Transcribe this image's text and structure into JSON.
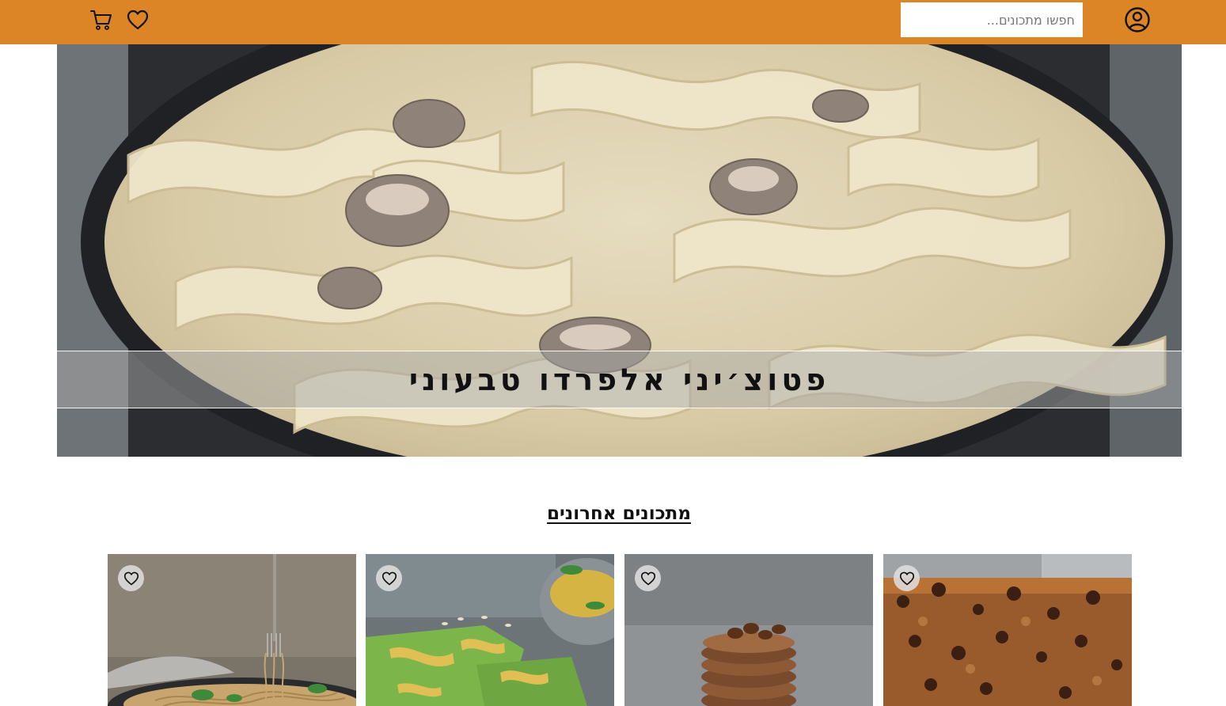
{
  "header": {
    "search_placeholder": "חפשו מתכונים...",
    "search_value": "",
    "icons": [
      "user-icon",
      "heart-icon",
      "cart-icon"
    ],
    "color": "#dc8526"
  },
  "hero": {
    "title": "פטוצ׳יני אלפרדו טבעוני",
    "image": "fettuccine-alfredo-photo"
  },
  "recent": {
    "heading": "מתכונים אחרונים",
    "cards": [
      {
        "image": "chocolate-chip-cake-photo",
        "fav_icon": "heart-icon"
      },
      {
        "image": "pancakes-stack-photo",
        "fav_icon": "heart-icon"
      },
      {
        "image": "green-spinach-crepes-photo",
        "fav_icon": "heart-icon"
      },
      {
        "image": "whole-wheat-spaghetti-photo",
        "fav_icon": "heart-icon"
      }
    ]
  }
}
